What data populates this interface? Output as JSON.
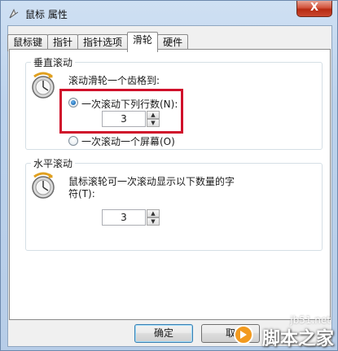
{
  "window": {
    "title": "鼠标 属性",
    "close_label": "X"
  },
  "tabs": [
    {
      "label": "鼠标键",
      "active": false
    },
    {
      "label": "指针",
      "active": false
    },
    {
      "label": "指针选项",
      "active": false
    },
    {
      "label": "滑轮",
      "active": true
    },
    {
      "label": "硬件",
      "active": false
    }
  ],
  "vertical": {
    "title": "垂直滚动",
    "prompt": "滚动滑轮一个齿格到:",
    "option_lines": "一次滚动下列行数(N):",
    "lines_value": "3",
    "option_screen": "一次滚动一个屏幕(O)"
  },
  "horizontal": {
    "title": "水平滚动",
    "prompt_line1": "鼠标滚轮可一次滚动显示以下数量的字",
    "prompt_line2": "符(T):",
    "chars_value": "3"
  },
  "buttons": {
    "ok": "确定",
    "cancel": "取"
  },
  "watermark": {
    "url": "jb51.net",
    "brand": "脚本之家"
  },
  "colors": {
    "highlight": "#d0112b",
    "close": "#c9472f"
  }
}
